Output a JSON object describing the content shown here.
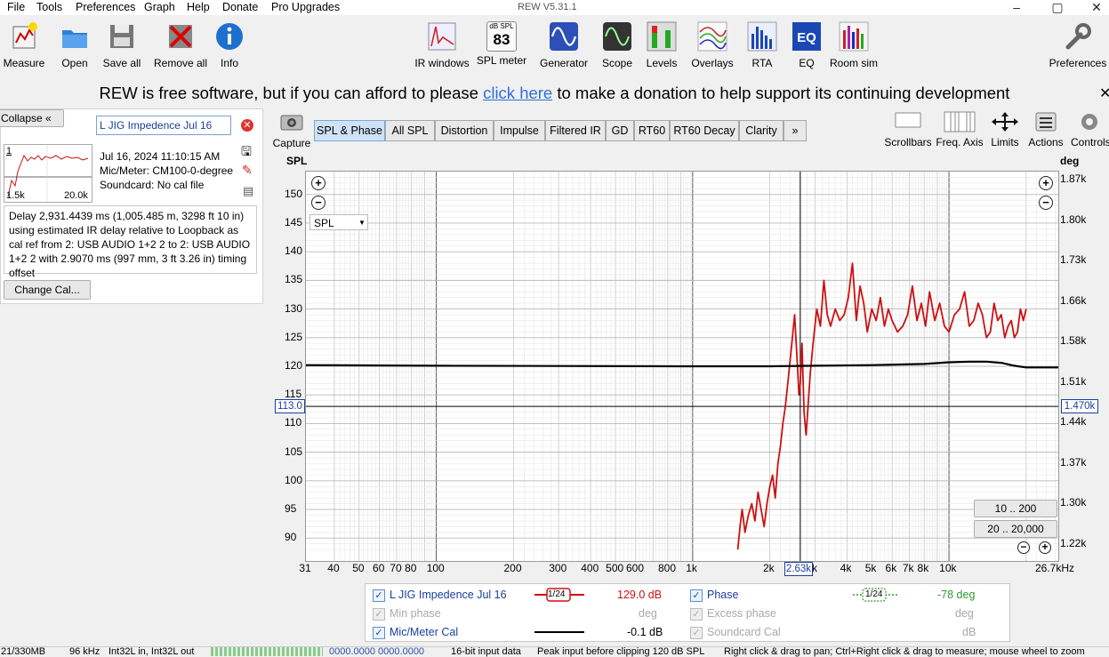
{
  "window": {
    "title": "REW V5.31.1",
    "menus": [
      "File",
      "Tools",
      "Preferences",
      "Graph",
      "Help",
      "Donate",
      "Pro Upgrades"
    ]
  },
  "toolbar": {
    "left": [
      "Measure",
      "Open",
      "Save all",
      "Remove all",
      "Info"
    ],
    "center": [
      "IR windows",
      "SPL meter",
      "Generator",
      "Scope",
      "Levels",
      "Overlays",
      "RTA",
      "EQ",
      "Room sim"
    ],
    "right": "Preferences",
    "spl_meter_top": "dB SPL",
    "spl_meter_value": "83"
  },
  "donation": {
    "before": "REW is free software, but if you can afford to please ",
    "link": "click here",
    "after": " to make a donation to help support its continuing development"
  },
  "left_panel": {
    "collapse_label": "Collapse",
    "measurement_name": "L JIG Impedence Jul 16",
    "thumb_index": "1",
    "thumb_x_min": "1.5k",
    "thumb_x_max": "20.0k",
    "date": "Jul 16, 2024 11:10:15 AM",
    "mic": "Mic/Meter: CM100-0-degree",
    "soundcard": "Soundcard: No cal file",
    "notes": "Delay 2,931.4439 ms (1,005.485 m, 3298 ft 10 in) using estimated IR delay relative to Loopback as cal ref from 2: USB AUDIO 1+2 2 to 2: USB AUDIO 1+2 2 with 2.9070 ms (997 mm, 3 ft 3.26 in) timing offset",
    "change_cal": "Change Cal..."
  },
  "graph_toolbar": {
    "capture": "Capture",
    "tabs": [
      "SPL & Phase",
      "All SPL",
      "Distortion",
      "Impulse",
      "Filtered IR",
      "GD",
      "RT60",
      "RT60 Decay",
      "Clarity"
    ],
    "more": "»",
    "right_controls": [
      "Scrollbars",
      "Freq. Axis",
      "Limits",
      "Actions",
      "Controls"
    ]
  },
  "graph": {
    "left_axis_title": "SPL",
    "right_axis_title": "deg",
    "dropdown": "SPL",
    "cursor_left_value": "113.0",
    "cursor_right_value": "1.470k",
    "cursor_freq": "2.63k",
    "range_button_1": "10 .. 200",
    "range_button_2": "20 .. 20,000"
  },
  "chart_data": {
    "type": "line",
    "x_scale": "log",
    "xlim": [
      31,
      26700
    ],
    "ylim": [
      86,
      154
    ],
    "y_ticks": [
      "150",
      "145",
      "140",
      "135",
      "130",
      "125",
      "120",
      "115",
      "110",
      "105",
      "100",
      "95",
      "90"
    ],
    "y2_ticks": [
      "1.87k",
      "1.80k",
      "1.73k",
      "1.66k",
      "1.58k",
      "1.51k",
      "1.44k",
      "1.37k",
      "1.30k",
      "1.22k"
    ],
    "x_ticks": [
      "31",
      "40",
      "50",
      "60",
      "70",
      "80",
      "100",
      "200",
      "300",
      "400",
      "500",
      "600",
      "800",
      "1k",
      "2k",
      "3k",
      "4k",
      "5k",
      "6k",
      "7k",
      "8k",
      "10k",
      "26.7kHz"
    ],
    "cursor": {
      "freq": 2630,
      "spl": 113.0
    },
    "series": [
      {
        "name": "L JIG Impedence Jul 16",
        "color": "#cc1111",
        "x": [
          1500,
          1530,
          1560,
          1600,
          1650,
          1700,
          1750,
          1800,
          1850,
          1900,
          1950,
          2000,
          2050,
          2100,
          2150,
          2200,
          2250,
          2300,
          2350,
          2400,
          2450,
          2500,
          2550,
          2600,
          2630,
          2670,
          2720,
          2770,
          2820,
          2880,
          2950,
          3050,
          3150,
          3250,
          3350,
          3450,
          3600,
          3750,
          3900,
          4050,
          4200,
          4350,
          4500,
          4650,
          4800,
          5000,
          5200,
          5400,
          5600,
          5800,
          6000,
          6300,
          6600,
          6900,
          7200,
          7500,
          7800,
          8100,
          8400,
          8800,
          9200,
          9600,
          10000,
          10500,
          11000,
          11500,
          12000,
          12500,
          13000,
          13500,
          14000,
          14500,
          15000,
          15500,
          16000,
          16500,
          17000,
          17500,
          18000,
          18500,
          19000,
          19500,
          20000
        ],
        "values": [
          88,
          92,
          95,
          91,
          94,
          96,
          93,
          98,
          95,
          92,
          96,
          99,
          101,
          97,
          103,
          106,
          110,
          113,
          117,
          121,
          125,
          129,
          122,
          115,
          117,
          124,
          112,
          108,
          113,
          119,
          124,
          130,
          127,
          135,
          129,
          127,
          130,
          128,
          129,
          132,
          138,
          128,
          134,
          131,
          126,
          130,
          128,
          132,
          127,
          130,
          128,
          126,
          127,
          129,
          134,
          128,
          131,
          127,
          133,
          128,
          131,
          127,
          126,
          129,
          130,
          133,
          127,
          128,
          131,
          129,
          125,
          126,
          131,
          128,
          129,
          125,
          127,
          128,
          125,
          126,
          130,
          128,
          130
        ]
      },
      {
        "name": "Mic/Meter Cal",
        "color": "#000000",
        "x": [
          31,
          100,
          1000,
          2000,
          3000,
          5000,
          8000,
          10000,
          12000,
          14000,
          16000,
          18000,
          20000,
          26700
        ],
        "values": [
          120.2,
          120.1,
          120.0,
          120.0,
          120.1,
          120.2,
          120.4,
          120.7,
          120.8,
          120.8,
          120.6,
          120.1,
          119.8,
          119.8
        ]
      }
    ]
  },
  "legend": {
    "row1": {
      "name": "L JIG Impedence Jul 16",
      "smoothing": "1/24",
      "value": "129.0 dB",
      "phase_label": "Phase",
      "phase_smoothing": "1/24",
      "phase_value": "-78 deg"
    },
    "row2": {
      "name": "Min phase",
      "unit": "deg",
      "excess": "Excess phase",
      "excess_unit": "deg"
    },
    "row3": {
      "name": "Mic/Meter Cal",
      "value": "-0.1 dB",
      "soundcard": "Soundcard Cal",
      "soundcard_unit": "dB"
    }
  },
  "status": {
    "memory": "21/330MB",
    "rate": "96 kHz",
    "format": "Int32L in, Int32L out",
    "levels": "0000.0000  0000.0000",
    "bits": "16-bit input data",
    "peak": "Peak input before clipping 120 dB SPL",
    "hint": "Right click & drag to pan; Ctrl+Right click & drag to measure; mouse wheel to zoom"
  },
  "colors": {
    "accent": "#2e6fd8",
    "series_red": "#cc1111",
    "phase_green": "#2e9b2e"
  }
}
